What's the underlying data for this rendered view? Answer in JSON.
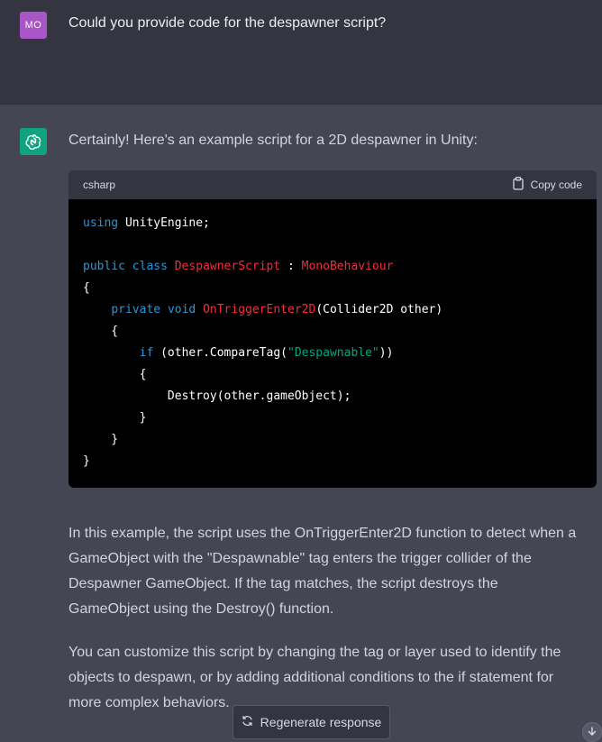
{
  "user_message": {
    "avatar_initials": "MO",
    "text": "Could you provide code for the despawner script?"
  },
  "assistant_message": {
    "avatar_icon": "openai-logo-icon",
    "intro": "Certainly! Here's an example script for a 2D despawner in Unity:",
    "code": {
      "language": "csharp",
      "copy_label": "Copy code",
      "lines": [
        "using UnityEngine;",
        "",
        "public class DespawnerScript : MonoBehaviour",
        "{",
        "    private void OnTriggerEnter2D(Collider2D other)",
        "    {",
        "        if (other.CompareTag(\"Despawnable\"))",
        "        {",
        "            Destroy(other.gameObject);",
        "        }",
        "    }",
        "}"
      ]
    },
    "paragraph_1": "In this example, the script uses the OnTriggerEnter2D function to detect when a GameObject with the \"Despawnable\" tag enters the trigger collider of the Despawner GameObject. If the tag matches, the script destroys the GameObject using the Destroy() function.",
    "paragraph_2": "You can customize this script by changing the tag or layer used to identify the objects to despawn, or by adding additional conditions to the if statement for more complex behaviors."
  },
  "regenerate_button": {
    "label": "Regenerate response",
    "icon": "refresh-icon"
  },
  "scroll_button": {
    "icon": "arrow-down-icon"
  },
  "colors": {
    "user_bg": "#343541",
    "assistant_bg": "#444654",
    "user_avatar": "#a855c7",
    "assistant_avatar": "#10a37f",
    "code_bg": "#000000",
    "keyword": "#2e95d3",
    "type": "#f22c3d",
    "string": "#00a67d"
  }
}
